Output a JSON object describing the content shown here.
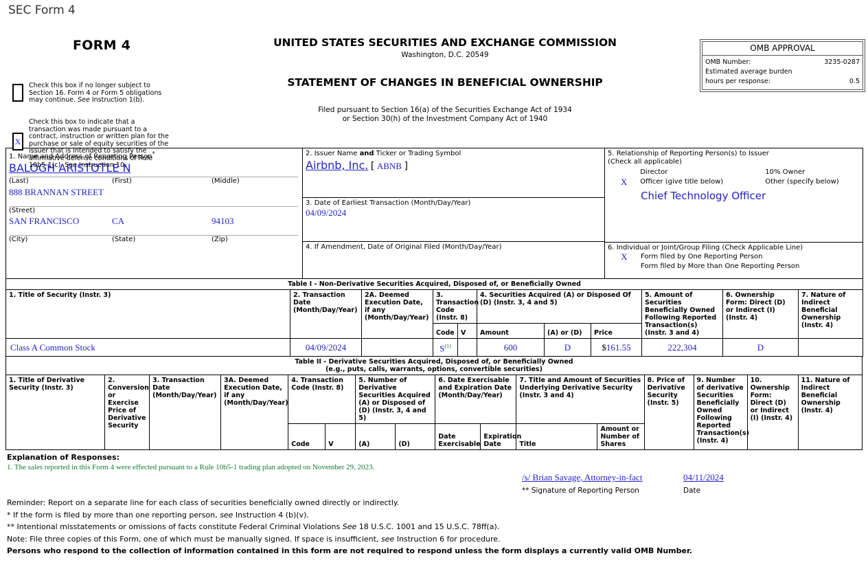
{
  "doc": {
    "sec_form_label": "SEC Form 4",
    "form_title": "FORM 4",
    "agency_title": "UNITED STATES SECURITIES AND EXCHANGE COMMISSION",
    "agency_address": "Washington, D.C. 20549",
    "statement_title": "STATEMENT OF CHANGES IN BENEFICIAL OWNERSHIP",
    "filed_line1": "Filed pursuant to Section 16(a) of the Securities Exchange Act of 1934",
    "filed_line2": "or Section 30(h) of the Investment Company Act of 1940"
  },
  "omb": {
    "title": "OMB APPROVAL",
    "number_label": "OMB Number:",
    "number_value": "3235-0287",
    "burden_label_1": "Estimated average burden",
    "burden_label_2": "hours per response:",
    "burden_value": "0.5"
  },
  "checkboxes": [
    {
      "mark": "",
      "text_parts": [
        "Check this box if no longer subject to Section 16. Form 4 or Form 5 obligations may continue. ",
        "See",
        " Instruction 1(b)."
      ]
    },
    {
      "mark": "X",
      "text_parts": [
        "Check this box to indicate that a transaction was made pursuant to a contract, instruction or written plan for the purchase or sale of equity securities of the issuer that is intended to satisfy the affirmative defense conditions of Rule 10b5-1(c). See Instruction 10.",
        "",
        ""
      ]
    }
  ],
  "box1": {
    "heading": "1. Name and Address of Reporting Person",
    "heading_mark": "*",
    "person_name": "BALOGH ARISTOTLE N",
    "cap_last": "(Last)",
    "cap_first": "(First)",
    "cap_middle": "(Middle)",
    "street": "888 BRANNAN STREET",
    "cap_street": "(Street)",
    "city": "SAN FRANCISCO",
    "state": "CA",
    "zip": "94103",
    "cap_city": "(City)",
    "cap_state": "(State)",
    "cap_zip": "(Zip)"
  },
  "box2": {
    "heading_a": "2. Issuer Name ",
    "heading_b": "and",
    "heading_c": " Ticker or Trading Symbol",
    "issuer_name": "Airbnb, Inc.",
    "ticker": "ABNB"
  },
  "box3": {
    "heading": "3. Date of Earliest Transaction (Month/Day/Year)",
    "value": "04/09/2024"
  },
  "box4": {
    "heading": "4. If Amendment, Date of Original Filed (Month/Day/Year)",
    "value": ""
  },
  "box5": {
    "heading_1": "5. Relationship of Reporting Person(s) to Issuer",
    "heading_2": "(Check all applicable)",
    "director_mark": "",
    "director_label": "Director",
    "tenpct_mark": "",
    "tenpct_label": "10% Owner",
    "officer_mark": "X",
    "officer_label": "Officer (give title below)",
    "other_mark": "",
    "other_label": "Other (specify below)",
    "officer_title": "Chief Technology Officer"
  },
  "box6": {
    "heading": "6. Individual or Joint/Group Filing (Check Applicable Line)",
    "one_mark": "X",
    "one_label": "Form filed by One Reporting Person",
    "more_mark": "",
    "more_label": "Form filed by More than One Reporting Person"
  },
  "table1": {
    "title": "Table I - Non-Derivative Securities Acquired, Disposed of, or Beneficially Owned",
    "headers": {
      "c1": "1. Title of Security (Instr. 3)",
      "c2": "2. Transaction Date (Month/Day/Year)",
      "c2a": "2A. Deemed Execution Date, if any (Month/Day/Year)",
      "c3": "3. Transaction Code (Instr. 8)",
      "c3_code": "Code",
      "c3_v": "V",
      "c4": "4. Securities Acquired (A) or Disposed Of (D) (Instr. 3, 4 and 5)",
      "c4_amount": "Amount",
      "c4_ad": "(A) or (D)",
      "c4_price": "Price",
      "c5": "5. Amount of Securities Beneficially Owned Following Reported Transaction(s) (Instr. 3 and 4)",
      "c6": "6. Ownership Form: Direct (D) or Indirect (I) (Instr. 4)",
      "c7": "7. Nature of Indirect Beneficial Ownership (Instr. 4)"
    },
    "rows": [
      {
        "security": "Class A Common Stock",
        "date": "04/09/2024",
        "deemed_date": "",
        "code": "S",
        "code_footnote": "(1)",
        "v": "",
        "amount": "600",
        "ad": "D",
        "price_symbol": "$",
        "price": "161.55",
        "owned_after": "222,304",
        "ownership_form": "D",
        "nature": ""
      }
    ]
  },
  "table2": {
    "title_line1": "Table II - Derivative Securities Acquired, Disposed of, or Beneficially Owned",
    "title_line2": "(e.g., puts, calls, warrants, options, convertible securities)",
    "headers": {
      "c1": "1. Title of Derivative Security (Instr. 3)",
      "c2": "2. Conversion or Exercise Price of Derivative Security",
      "c3": "3. Transaction Date (Month/Day/Year)",
      "c3a": "3A. Deemed Execution Date, if any (Month/Day/Year)",
      "c4": "4. Transaction Code (Instr. 8)",
      "c4_code": "Code",
      "c4_v": "V",
      "c5": "5. Number of Derivative Securities Acquired (A) or Disposed of (D) (Instr. 3, 4 and 5)",
      "c5_a": "(A)",
      "c5_d": "(D)",
      "c6": "6. Date Exercisable and Expiration Date (Month/Day/Year)",
      "c6_exercisable": "Date Exercisable",
      "c6_expiration": "Expiration Date",
      "c7": "7. Title and Amount of Securities Underlying Derivative Security (Instr. 3 and 4)",
      "c7_title": "Title",
      "c7_amount": "Amount or Number of Shares",
      "c8": "8. Price of Derivative Security (Instr. 5)",
      "c9": "9. Number of derivative Securities Beneficially Owned Following Reported Transaction(s) (Instr. 4)",
      "c10": "10. Ownership Form: Direct (D) or Indirect (I) (Instr. 4)",
      "c11": "11. Nature of Indirect Beneficial Ownership (Instr. 4)"
    },
    "rows": []
  },
  "footer": {
    "explanation_heading": "Explanation of Responses:",
    "explanations": [
      "1. The sales reported in this Form 4 were effected pursuant to a Rule 10b5-1 trading plan adopted on November 29, 2023."
    ],
    "signature": "/s/ Brian Savage, Attorney-in-fact",
    "signature_date": "04/11/2024",
    "signature_caption": "** Signature of Reporting Person",
    "date_caption": "Date",
    "reminder": "Reminder: Report on a separate line for each class of securities beneficially owned directly or indirectly.",
    "note_star_a": "* If the form is filed by more than one reporting person, ",
    "note_star_it": "see",
    "note_star_b": " Instruction 4 (b)(v).",
    "note_dstar_a": "** Intentional misstatements or omissions of facts constitute Federal Criminal Violations ",
    "note_dstar_it": "See",
    "note_dstar_b": " 18 U.S.C. 1001 and 15 U.S.C. 78ff(a).",
    "note_note_a": "Note: File three copies of this Form, one of which must be manually signed. If space is insufficient, ",
    "note_note_it": "see",
    "note_note_b": " Instruction 6 for procedure.",
    "bold_note": "Persons who respond to the collection of information contained in this form are not required to respond unless the form displays a currently valid OMB Number."
  }
}
